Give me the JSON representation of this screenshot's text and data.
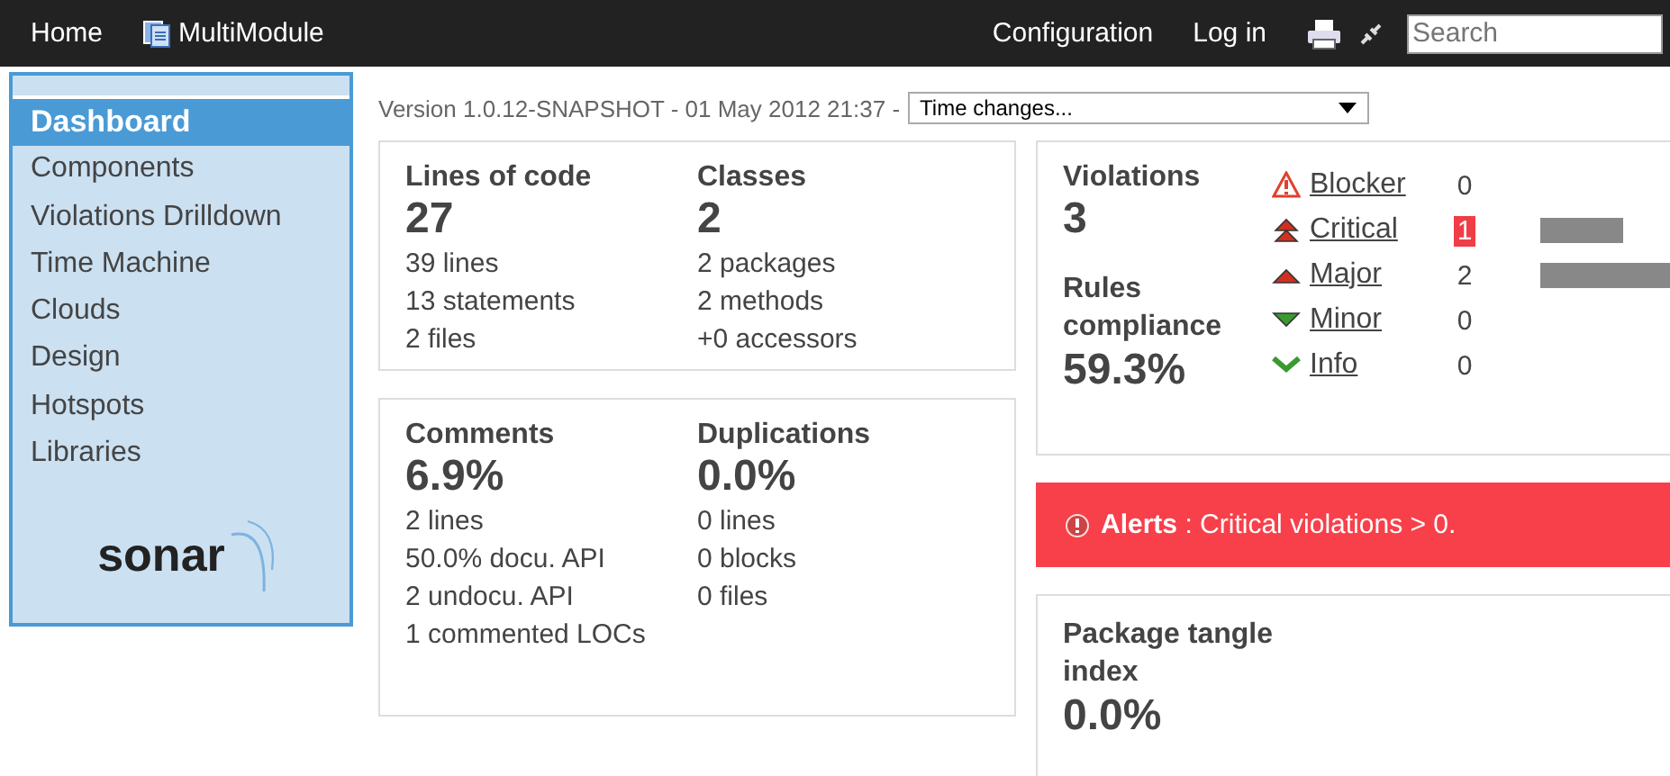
{
  "topbar": {
    "home": "Home",
    "project": "MultiModule",
    "configuration": "Configuration",
    "login": "Log in",
    "search": {
      "placeholder": "Search"
    }
  },
  "sidebar": {
    "items": [
      {
        "label": "Dashboard",
        "selected": true
      },
      {
        "label": "Components",
        "selected": false
      },
      {
        "label": "Violations Drilldown",
        "selected": false
      },
      {
        "label": "Time Machine",
        "selected": false
      },
      {
        "label": "Clouds",
        "selected": false
      },
      {
        "label": "Design",
        "selected": false
      },
      {
        "label": "Hotspots",
        "selected": false
      },
      {
        "label": "Libraries",
        "selected": false
      }
    ],
    "logo": "sonar"
  },
  "version_line": "Version 1.0.12-SNAPSHOT - 01 May 2012 21:37 -",
  "time_select": "Time changes...",
  "cards": [
    [
      {
        "title": "Lines of code",
        "value": "27",
        "details": [
          "39 lines",
          "13 statements",
          "2 files"
        ]
      },
      {
        "title": "Classes",
        "value": "2",
        "details": [
          "2 packages",
          "2 methods",
          "+0 accessors"
        ]
      }
    ],
    [
      {
        "title": "Comments",
        "value": "6.9%",
        "details": [
          "2 lines",
          "50.0% docu. API",
          "2 undocu. API",
          "1 commented LOCs"
        ]
      },
      {
        "title": "Duplications",
        "value": "0.0%",
        "details": [
          "0 lines",
          "0 blocks",
          "0 files"
        ]
      }
    ]
  ],
  "violations": {
    "title": "Violations",
    "value": "3",
    "compliance_title": "Rules compliance",
    "compliance_value": "59.3%",
    "severities": [
      {
        "kind": "blocker",
        "label": "Blocker",
        "count": "0",
        "highlighted": false
      },
      {
        "kind": "critical",
        "label": "Critical",
        "count": "1",
        "highlighted": true
      },
      {
        "kind": "major",
        "label": "Major",
        "count": "2",
        "highlighted": false
      },
      {
        "kind": "minor",
        "label": "Minor",
        "count": "0",
        "highlighted": false
      },
      {
        "kind": "info",
        "label": "Info",
        "count": "0",
        "highlighted": false
      }
    ]
  },
  "alert": {
    "label": "Alerts",
    "text": " : Critical violations > 0."
  },
  "tangle": {
    "title": "Package tangle index",
    "value": "0.0%"
  }
}
